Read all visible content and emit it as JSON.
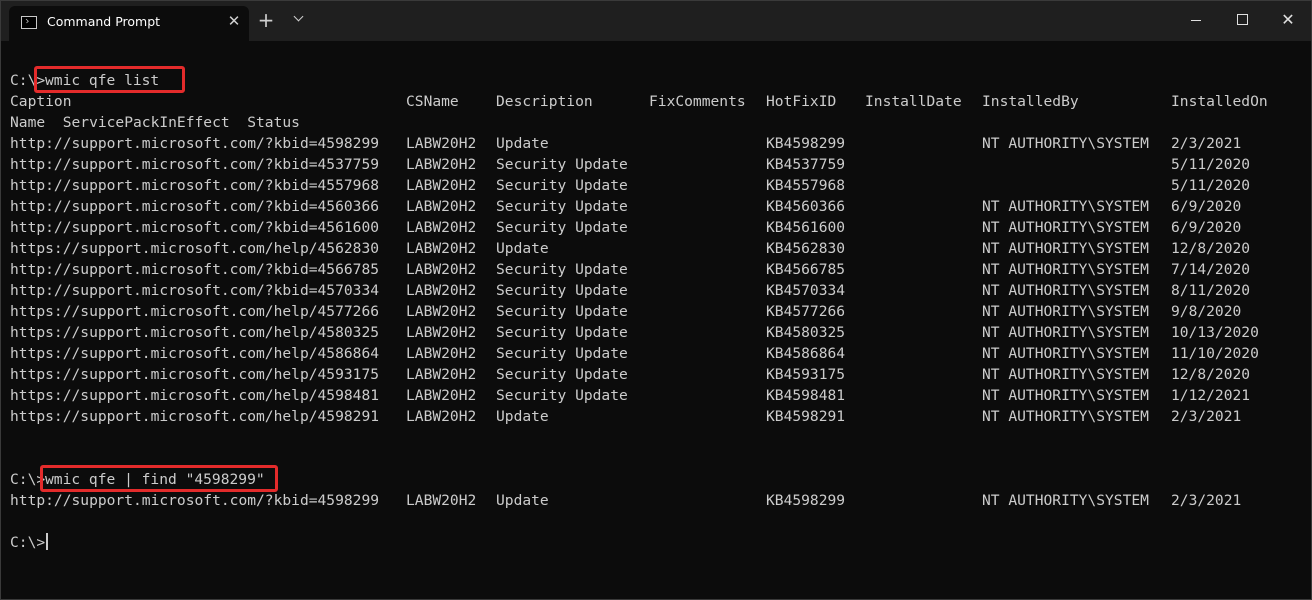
{
  "window": {
    "tab_title": "Command Prompt",
    "tab_close": "✕",
    "new_tab": "+",
    "close_glyph": "✕",
    "icons": [
      "cmd-icon",
      "close-icon",
      "plus-icon",
      "chevron-down-icon",
      "minimize-icon",
      "maximize-icon",
      "close-icon"
    ]
  },
  "terminal": {
    "prompt": "C:\\>",
    "command1": "wmic qfe list",
    "header1": [
      "Caption",
      "CSName",
      "Description",
      "FixComments",
      "HotFixID",
      "InstallDate",
      "InstalledBy",
      "InstalledOn"
    ],
    "header2": "Name  ServicePackInEffect  Status",
    "rows": [
      [
        "http://support.microsoft.com/?kbid=4598299",
        "LABW20H2",
        "Update",
        "KB4598299",
        "NT AUTHORITY\\SYSTEM",
        "2/3/2021"
      ],
      [
        "http://support.microsoft.com/?kbid=4537759",
        "LABW20H2",
        "Security Update",
        "KB4537759",
        "",
        "5/11/2020"
      ],
      [
        "http://support.microsoft.com/?kbid=4557968",
        "LABW20H2",
        "Security Update",
        "KB4557968",
        "",
        "5/11/2020"
      ],
      [
        "http://support.microsoft.com/?kbid=4560366",
        "LABW20H2",
        "Security Update",
        "KB4560366",
        "NT AUTHORITY\\SYSTEM",
        "6/9/2020"
      ],
      [
        "http://support.microsoft.com/?kbid=4561600",
        "LABW20H2",
        "Security Update",
        "KB4561600",
        "NT AUTHORITY\\SYSTEM",
        "6/9/2020"
      ],
      [
        "https://support.microsoft.com/help/4562830",
        "LABW20H2",
        "Update",
        "KB4562830",
        "NT AUTHORITY\\SYSTEM",
        "12/8/2020"
      ],
      [
        "http://support.microsoft.com/?kbid=4566785",
        "LABW20H2",
        "Security Update",
        "KB4566785",
        "NT AUTHORITY\\SYSTEM",
        "7/14/2020"
      ],
      [
        "http://support.microsoft.com/?kbid=4570334",
        "LABW20H2",
        "Security Update",
        "KB4570334",
        "NT AUTHORITY\\SYSTEM",
        "8/11/2020"
      ],
      [
        "https://support.microsoft.com/help/4577266",
        "LABW20H2",
        "Security Update",
        "KB4577266",
        "NT AUTHORITY\\SYSTEM",
        "9/8/2020"
      ],
      [
        "https://support.microsoft.com/help/4580325",
        "LABW20H2",
        "Security Update",
        "KB4580325",
        "NT AUTHORITY\\SYSTEM",
        "10/13/2020"
      ],
      [
        "https://support.microsoft.com/help/4586864",
        "LABW20H2",
        "Security Update",
        "KB4586864",
        "NT AUTHORITY\\SYSTEM",
        "11/10/2020"
      ],
      [
        "https://support.microsoft.com/help/4593175",
        "LABW20H2",
        "Security Update",
        "KB4593175",
        "NT AUTHORITY\\SYSTEM",
        "12/8/2020"
      ],
      [
        "https://support.microsoft.com/help/4598481",
        "LABW20H2",
        "Security Update",
        "KB4598481",
        "NT AUTHORITY\\SYSTEM",
        "1/12/2021"
      ],
      [
        "https://support.microsoft.com/help/4598291",
        "LABW20H2",
        "Update",
        "KB4598291",
        "NT AUTHORITY\\SYSTEM",
        "2/3/2021"
      ]
    ],
    "command2": "wmic qfe | find \"4598299\"",
    "find_result": [
      "http://support.microsoft.com/?kbid=4598299",
      "LABW20H2",
      "Update",
      "KB4598299",
      "NT AUTHORITY\\SYSTEM",
      "2/3/2021"
    ],
    "highlight_color": "#e32b2b",
    "text_color": "#cccccc",
    "background_color": "#0c0c0c"
  }
}
